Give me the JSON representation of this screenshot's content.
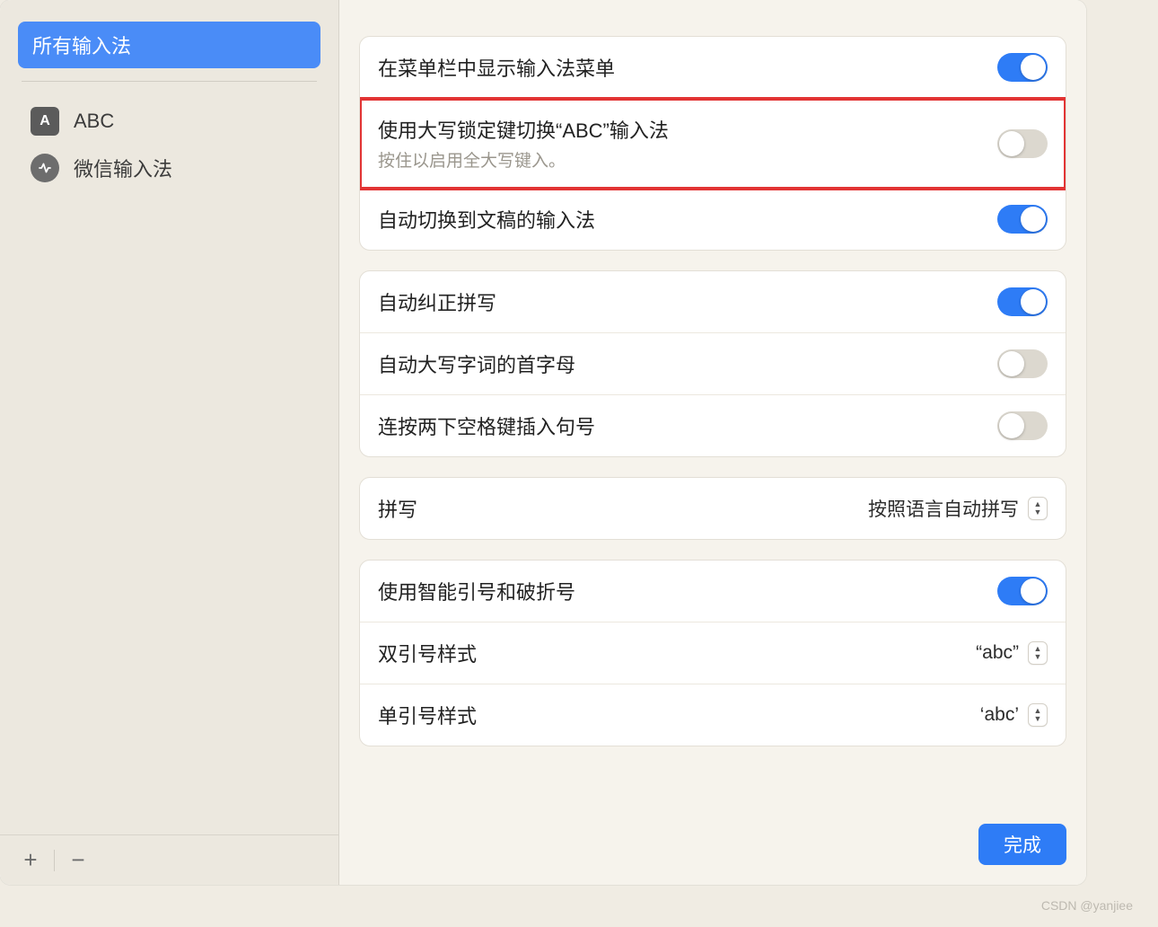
{
  "sidebar": {
    "selected_label": "所有输入法",
    "items": [
      {
        "label": "ABC",
        "icon_text": "A"
      },
      {
        "label": "微信输入法"
      }
    ],
    "add_label": "+",
    "remove_label": "−"
  },
  "settings": {
    "group1": {
      "row1": {
        "title": "在菜单栏中显示输入法菜单",
        "on": true
      },
      "row2": {
        "title": "使用大写锁定键切换“ABC”输入法",
        "subtitle": "按住以启用全大写键入。",
        "on": false
      },
      "row3": {
        "title": "自动切换到文稿的输入法",
        "on": true
      }
    },
    "group2": {
      "row1": {
        "title": "自动纠正拼写",
        "on": true
      },
      "row2": {
        "title": "自动大写字词的首字母",
        "on": false
      },
      "row3": {
        "title": "连按两下空格键插入句号",
        "on": false
      }
    },
    "group3": {
      "row1": {
        "title": "拼写",
        "value": "按照语言自动拼写"
      }
    },
    "group4": {
      "row1": {
        "title": "使用智能引号和破折号",
        "on": true
      },
      "row2": {
        "title": "双引号样式",
        "value": "“abc”"
      },
      "row3": {
        "title": "单引号样式",
        "value": "‘abc’"
      }
    }
  },
  "footer": {
    "done_label": "完成"
  },
  "watermark": "CSDN @yanjiee"
}
